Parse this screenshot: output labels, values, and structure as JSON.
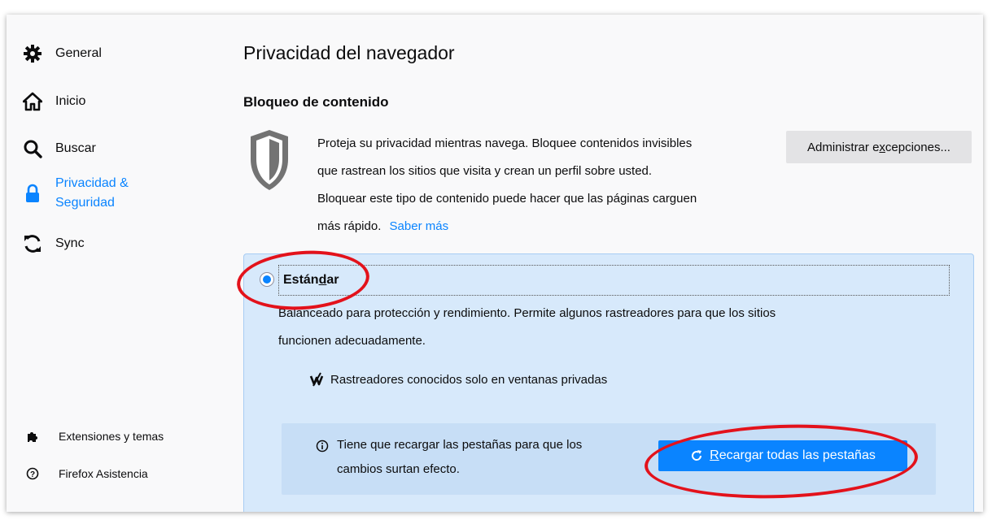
{
  "sidebar": {
    "items": [
      {
        "label": "General",
        "icon": "gear-icon"
      },
      {
        "label": "Inicio",
        "icon": "home-icon"
      },
      {
        "label": "Buscar",
        "icon": "search-icon"
      },
      {
        "label_line1": "Privacidad &",
        "label_line2": "Seguridad",
        "icon": "lock-icon",
        "active": true
      },
      {
        "label": "Sync",
        "icon": "sync-icon"
      }
    ],
    "footer": [
      {
        "label": "Extensiones y temas",
        "icon": "puzzle-icon"
      },
      {
        "label": "Firefox Asistencia",
        "icon": "help-icon"
      }
    ]
  },
  "main": {
    "title": "Privacidad del navegador",
    "section_title": "Bloqueo de contenido",
    "description": {
      "line1": "Proteja su privacidad mientras navega. Bloquee contenidos invisibles",
      "line2": "que rastrean los sitios que visita y crean un perfil sobre usted.",
      "line3": "Bloquear este tipo de contenido puede hacer que las páginas carguen",
      "line4": "más rápido.",
      "learn_more": "Saber más"
    },
    "exceptions_button": {
      "pre": "Administrar e",
      "accesskey": "x",
      "post": "cepciones..."
    },
    "standard": {
      "label_pre": "Están",
      "label_accesskey": "d",
      "label_post": "ar",
      "selected": true,
      "description_line1": "Balanceado para protección y rendimiento. Permite algunos rastreadores para que los sitios",
      "description_line2": "funcionen adecuadamente.",
      "trackers_label": "Rastreadores conocidos solo en ventanas privadas"
    },
    "reload": {
      "message_line1": "Tiene que recargar las pestañas para que los",
      "message_line2": "cambios surtan efecto.",
      "button_accesskey": "R",
      "button_rest": "ecargar todas las pestañas"
    }
  },
  "colors": {
    "accent": "#0a84ff",
    "annotation": "#e3121b",
    "standard_box_bg": "#d7e9fb",
    "reload_box_bg": "#c7def6"
  }
}
